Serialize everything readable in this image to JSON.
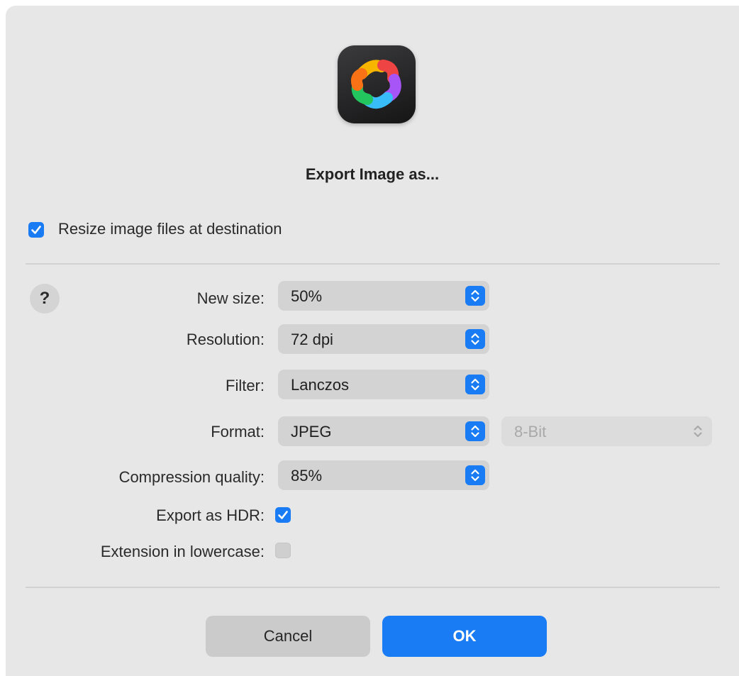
{
  "dialog": {
    "title": "Export Image as...",
    "app_icon": "app-logo-icon"
  },
  "resize": {
    "label": "Resize image files at destination",
    "checked": true
  },
  "help": {
    "glyph": "?"
  },
  "options": {
    "new_size": {
      "label": "New size:",
      "value": "50%"
    },
    "resolution": {
      "label": "Resolution:",
      "value": "72 dpi"
    },
    "filter": {
      "label": "Filter:",
      "value": "Lanczos"
    },
    "format": {
      "label": "Format:",
      "value": "JPEG",
      "bit_depth": "8-Bit",
      "bit_depth_enabled": false
    },
    "compression": {
      "label": "Compression quality:",
      "value": "85%"
    },
    "hdr": {
      "label": "Export as HDR:",
      "checked": true
    },
    "lowercase": {
      "label": "Extension in lowercase:",
      "checked": false
    }
  },
  "buttons": {
    "cancel": "Cancel",
    "ok": "OK"
  },
  "colors": {
    "accent": "#1a7cf5",
    "background": "#e7e7e7"
  }
}
